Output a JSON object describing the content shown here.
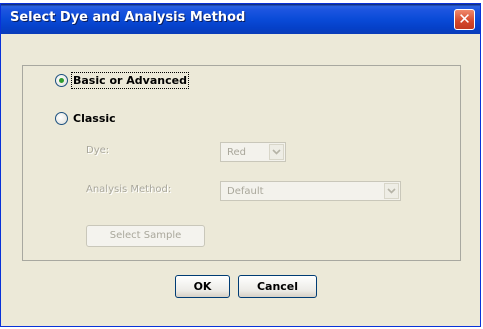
{
  "window": {
    "title": "Select Dye and Analysis Method",
    "close_symbol": "✕"
  },
  "options": {
    "basic_label": "Basic or Advanced",
    "basic_selected": true,
    "classic_label": "Classic",
    "classic_selected": false
  },
  "classic": {
    "dye_label": "Dye:",
    "dye_value": "Red",
    "analysis_label": "Analysis Method:",
    "analysis_value": "Default",
    "select_sample_label": "Select Sample"
  },
  "buttons": {
    "ok_label": "OK",
    "cancel_label": "Cancel"
  },
  "icons": {
    "close": "close-icon",
    "dropdown": "chevron-down-icon"
  }
}
